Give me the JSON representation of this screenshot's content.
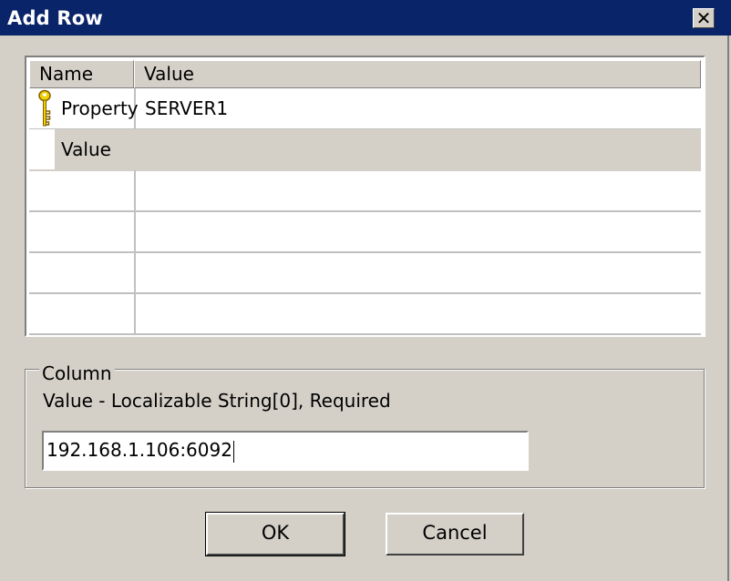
{
  "window": {
    "title": "Add Row",
    "close_label": "✕"
  },
  "grid": {
    "columns": [
      "Name",
      "Value"
    ],
    "rows": [
      {
        "name": "Property",
        "value": "SERVER1",
        "key": true,
        "selected": false
      },
      {
        "name": "Value",
        "value": "",
        "key": false,
        "selected": true
      },
      {
        "name": "",
        "value": "",
        "key": false,
        "selected": false
      },
      {
        "name": "",
        "value": "",
        "key": false,
        "selected": false
      },
      {
        "name": "",
        "value": "",
        "key": false,
        "selected": false
      },
      {
        "name": "",
        "value": "",
        "key": false,
        "selected": false
      }
    ]
  },
  "column_group": {
    "legend": "Column",
    "description": "Value - Localizable String[0], Required",
    "input_value": "192.168.1.106:6092"
  },
  "buttons": {
    "ok_label": "OK",
    "cancel_label": "Cancel"
  },
  "icons": {
    "key": "key-icon",
    "close": "close-icon"
  },
  "colors": {
    "titlebar": "#0a246a",
    "dialog_face": "#d4d0c8",
    "key_icon": "#f0d000"
  }
}
